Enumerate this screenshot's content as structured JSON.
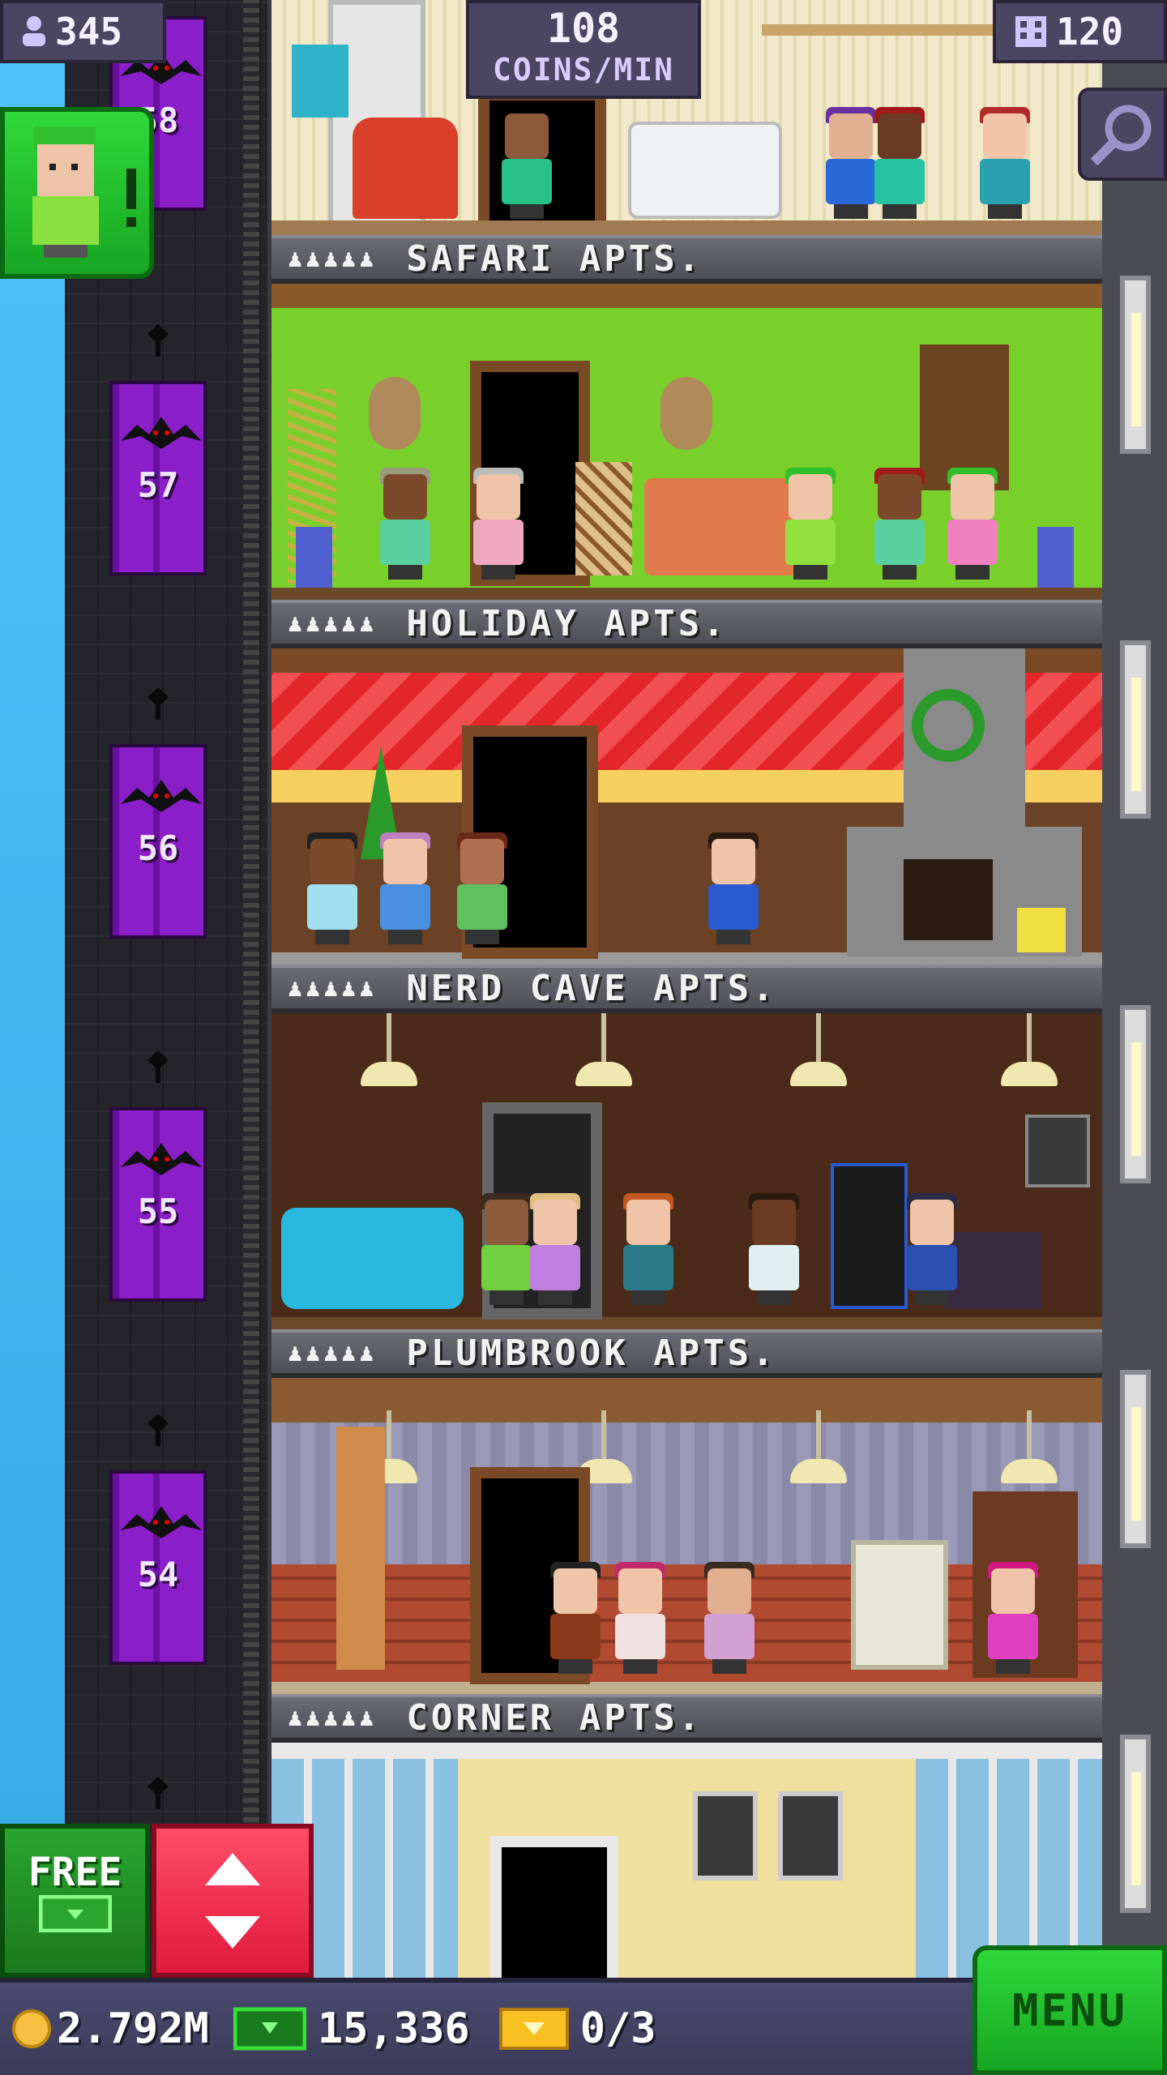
{
  "hud": {
    "population": "345",
    "coins_rate_value": "108",
    "coins_rate_label": "COINS/MIN",
    "floor_count": "120"
  },
  "elevator": {
    "floors": [
      "58",
      "57",
      "56",
      "55",
      "54"
    ]
  },
  "floors": [
    {
      "name": "SAFARI APTS.",
      "residents": "♟♟♟♟♟"
    },
    {
      "name": "HOLIDAY APTS.",
      "residents": "♟♟♟♟♟"
    },
    {
      "name": "NERD CAVE APTS.",
      "residents": "♟♟♟♟♟"
    },
    {
      "name": "PLUMBROOK APTS.",
      "residents": "♟♟♟♟♟"
    },
    {
      "name": "CORNER APTS.",
      "residents": "♟♟♟♟♟"
    }
  ],
  "buttons": {
    "free_label": "FREE",
    "menu_label": "MENU"
  },
  "bottom_bar": {
    "coins": "2.792M",
    "bux": "15,336",
    "tickets": "0/3"
  },
  "colors": {
    "accent_green": "#2fd93a",
    "elevator_purple": "#8a1ec8",
    "lift_red": "#e01a3c",
    "hud_panel": "#4a4560"
  }
}
